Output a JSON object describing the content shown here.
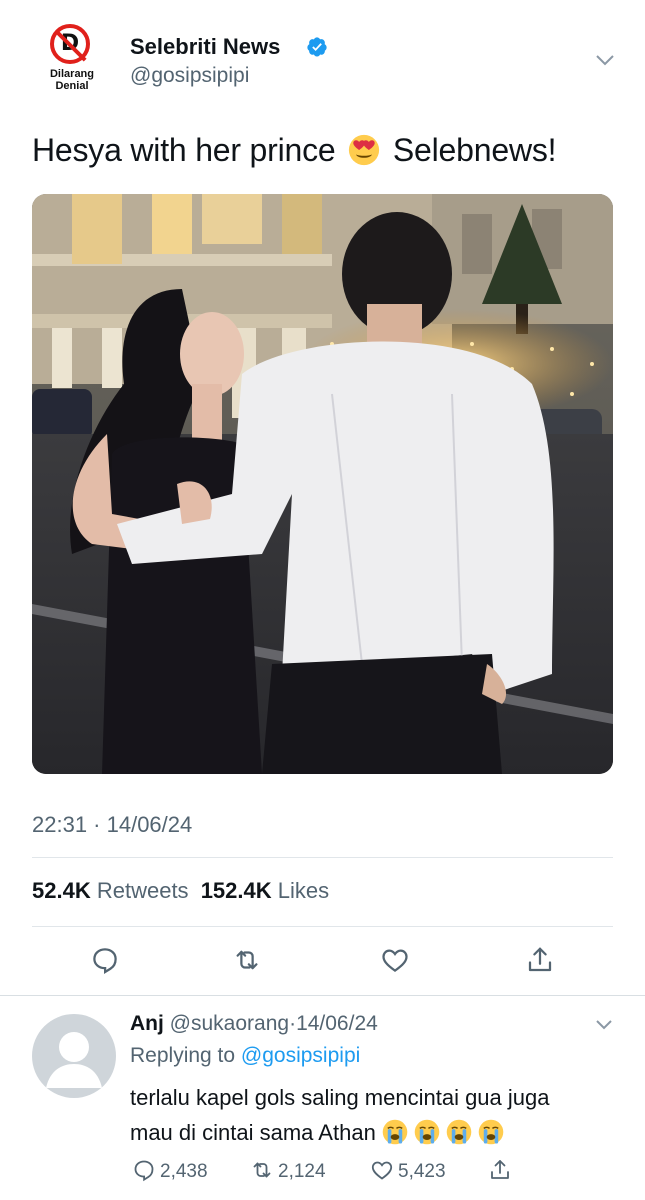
{
  "account": {
    "logo_text_line1": "Dilarang",
    "logo_text_line2": "Denial",
    "logo_letter": "D",
    "name": "Selebriti News",
    "handle": "@gosipsipipi",
    "verified_color": "#1d9bf0"
  },
  "tweet": {
    "text_before": "Hesya with her prince",
    "emoji": "heart-eyes-emoji",
    "text_after": "Selebnews!",
    "timestamp": "22:31 · 14/06/24",
    "retweets_count": "52.4K",
    "retweets_label": "Retweets",
    "likes_count": "152.4K",
    "likes_label": "Likes"
  },
  "actions": [
    "reply-icon",
    "retweet-icon",
    "like-icon",
    "share-icon"
  ],
  "reply": {
    "name": "Anj",
    "handle": "@sukaorang",
    "date": "14/06/24",
    "replying_prefix": "Replying to",
    "replying_to": "@gosipsipipi",
    "text_line1": "terlalu kapel gols saling mencintai gua juga",
    "text_line2": "mau di cintai sama Athan",
    "emoji": "crying-face-emoji",
    "emoji_count": 4,
    "reply_count": "2,438",
    "retweet_count": "2,124",
    "like_count": "5,423"
  },
  "colors": {
    "accent": "#1d9bf0",
    "secondary_text": "#536471",
    "logo_red": "#e0201b"
  }
}
